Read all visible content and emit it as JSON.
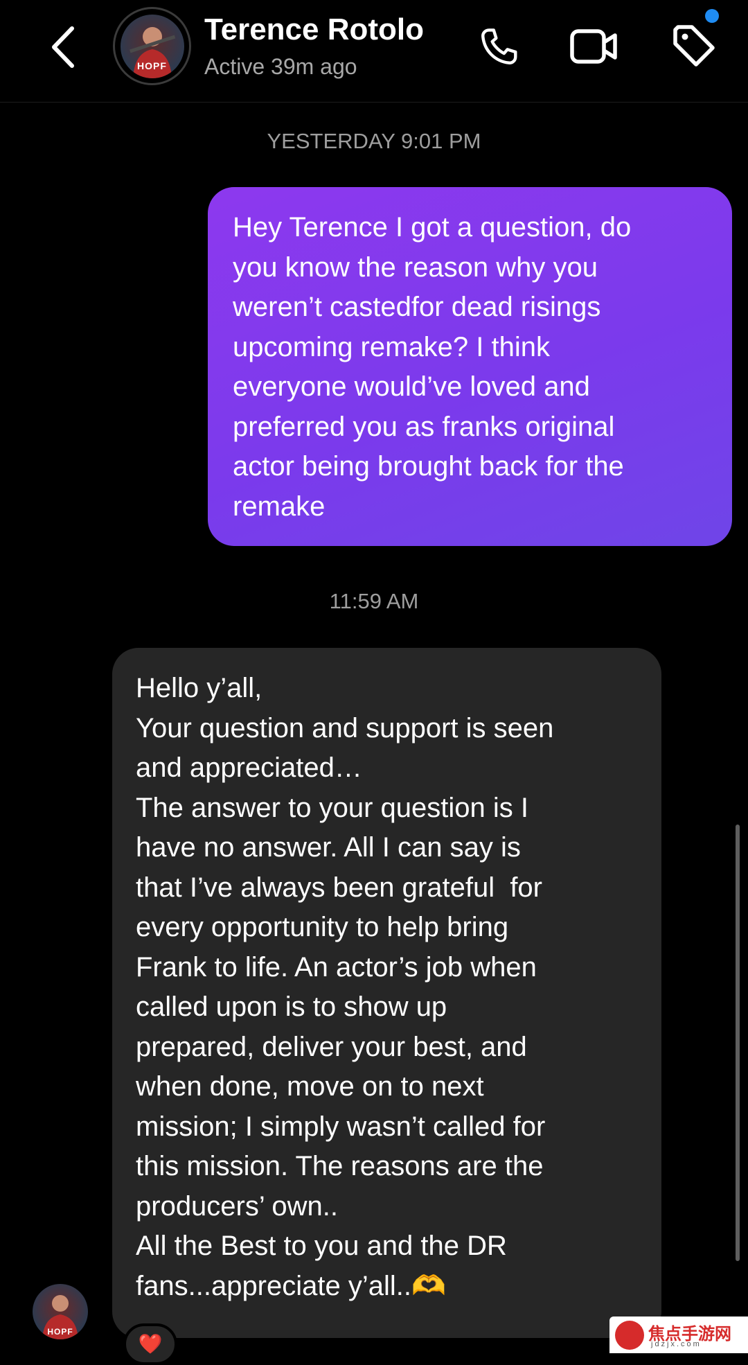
{
  "header": {
    "contact_name": "Terence Rotolo",
    "status": "Active 39m ago",
    "avatar_text": "HOPF",
    "icons": [
      "back-chevron-icon",
      "phone-icon",
      "video-camera-icon",
      "tag-icon"
    ],
    "notification_dot_color": "#1f8cf3"
  },
  "thread": {
    "timestamp_1": "YESTERDAY 9:01 PM",
    "outgoing_message": "Hey Terence I got a question, do\nyou know the reason why you\nweren’t castedfor dead risings\nupcoming remake? I think\neveryone would’ve loved and\npreferred you as franks original\nactor being brought back for the\nremake",
    "timestamp_2": "11:59 AM",
    "incoming_message": "Hello y’all,\nYour question and support is seen\nand appreciated…\nThe answer to your question is I\nhave no answer. All I can say is\nthat I’ve always been grateful  for\nevery opportunity to help bring\nFrank to life. An actor’s job when\ncalled upon is to show up\nprepared, deliver your best, and\nwhen done, move on to next\nmission; I simply wasn’t called for\nthis mission. The reasons are the\nproducers’ own..\nAll the Best to you and the DR\nfans...appreciate y’all..🫶",
    "reaction_emoji": "❤️",
    "sender_avatar_text": "HOPF"
  },
  "colors": {
    "outgoing_bubble": "#7f3cec",
    "incoming_bubble": "#262626",
    "background": "#000000"
  },
  "watermark": {
    "title": "焦点手游网",
    "subtitle": "jdzjx.com"
  }
}
